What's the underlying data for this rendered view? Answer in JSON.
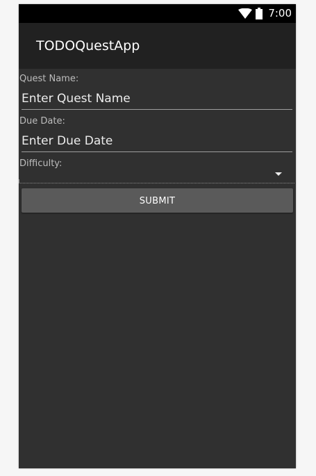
{
  "status_bar": {
    "time": "7:00",
    "icons": [
      "wifi-icon",
      "battery-icon"
    ]
  },
  "app_bar": {
    "title": "TODOQuestApp"
  },
  "form": {
    "quest_name": {
      "label": "Quest Name:",
      "placeholder": "Enter Quest Name",
      "value": ""
    },
    "due_date": {
      "label": "Due Date:",
      "placeholder": "Enter Due Date",
      "value": ""
    },
    "difficulty": {
      "label": "Difficulty:",
      "selected": ""
    },
    "submit_label": "SUBMIT"
  },
  "colors": {
    "status_bar": "#000000",
    "app_bar": "#212121",
    "background": "#303030",
    "button": "#5a5a5a"
  }
}
